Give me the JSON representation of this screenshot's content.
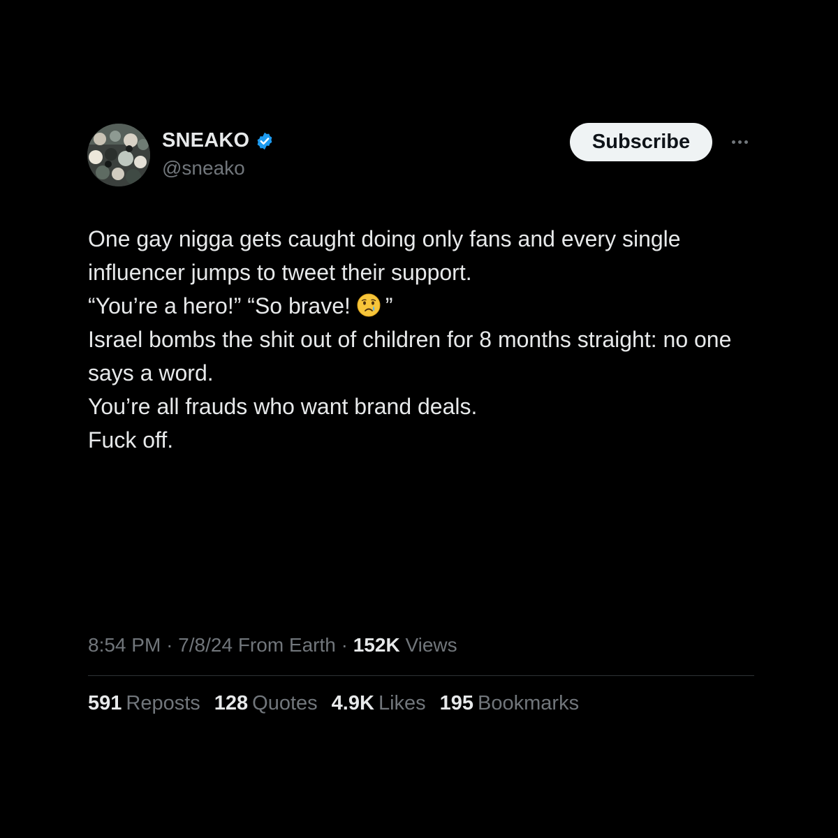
{
  "author": {
    "display_name": "SNEAKO",
    "handle": "@sneako",
    "verified": true,
    "verified_color": "#1d9bf0"
  },
  "actions": {
    "subscribe_label": "Subscribe",
    "more_icon": "more-horizontal-icon"
  },
  "tweet": {
    "paragraphs": [
      "One gay nigga gets caught doing only fans and every single influencer jumps to tweet their support.",
      "“You’re a hero!” “So brave!",
      "”",
      "Israel bombs the shit out of children for 8 months straight: no one says a word.",
      "You’re all frauds who want brand deals.",
      "Fuck off."
    ],
    "emoji": "crying-face-emoji"
  },
  "meta": {
    "time": "8:54 PM",
    "sep1": "·",
    "date": "7/8/24",
    "location": "From Earth",
    "sep2": "·",
    "views_count": "152K",
    "views_label": "Views"
  },
  "stats": [
    {
      "count": "591",
      "label": "Reposts"
    },
    {
      "count": "128",
      "label": "Quotes"
    },
    {
      "count": "4.9K",
      "label": "Likes"
    },
    {
      "count": "195",
      "label": "Bookmarks"
    }
  ]
}
